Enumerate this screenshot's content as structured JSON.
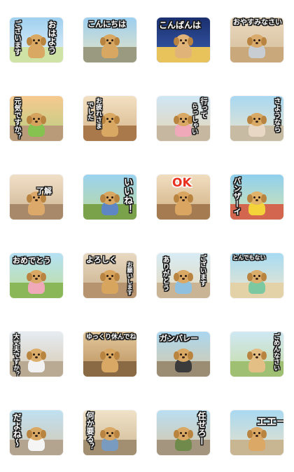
{
  "stickers": [
    {
      "lines": [
        "おはよう",
        "ございます"
      ],
      "bg": [
        "#9fd0ef",
        "#e9f3fa"
      ],
      "ground": "#cfe3a6",
      "fur": "#d9a964",
      "outfit": ""
    },
    {
      "lines": [
        "こんにちは"
      ],
      "bg": [
        "#9ccff0",
        "#e8e4c4"
      ],
      "ground": "#9a9a80",
      "fur": "#d8a862",
      "outfit": ""
    },
    {
      "lines": [
        "こんばんは"
      ],
      "bg": [
        "#1a2f6e",
        "#3a5fb0"
      ],
      "ground": "#e8c25a",
      "fur": "#e0b478",
      "outfit": ""
    },
    {
      "lines": [
        "おやすみなさい"
      ],
      "bg": [
        "#ead9bf",
        "#d3bc98"
      ],
      "ground": "#c9a87b",
      "fur": "#d9ab6c",
      "outfit": "#c8cdd4"
    },
    {
      "lines": [
        "元気ですか？"
      ],
      "bg": [
        "#f7c98f",
        "#b7cf83"
      ],
      "ground": "#b99b7a",
      "fur": "#d6a35e",
      "outfit": "#86c24f"
    },
    {
      "lines": [
        "お疲れさま",
        "でした"
      ],
      "bg": [
        "#f3e0c2",
        "#d4b58a"
      ],
      "ground": "#a9794c",
      "fur": "#d9a862",
      "outfit": ""
    },
    {
      "lines": [
        "行って",
        "らっしゃい"
      ],
      "bg": [
        "#cfe6f5",
        "#e6d5b4"
      ],
      "ground": "#c6b7a0",
      "fur": "#d9a864",
      "outfit": "#f0a9b8"
    },
    {
      "lines": [
        "さようなら"
      ],
      "bg": [
        "#a8d8f2",
        "#ece4cc"
      ],
      "ground": "#c7bba4",
      "fur": "#d9aa66",
      "outfit": "#e9d7c6"
    },
    {
      "lines": [
        "了解"
      ],
      "bg": [
        "#f0dfc7",
        "#cdb391"
      ],
      "ground": "#a88a6a",
      "fur": "#dca96a",
      "outfit": ""
    },
    {
      "lines": [
        "いいね！"
      ],
      "bg": [
        "#9bd3f0",
        "#bcd99b"
      ],
      "ground": "#7aa24a",
      "fur": "#d8a862",
      "outfit": "#5f86c4"
    },
    {
      "lines": [
        "OK"
      ],
      "bg": [
        "#f0ddc0",
        "#cfae80"
      ],
      "ground": "#a57c52",
      "fur": "#d9a560",
      "outfit": ""
    },
    {
      "lines": [
        "バンザーイ"
      ],
      "bg": [
        "#8fd0ee",
        "#d6e4b0"
      ],
      "ground": "#d3664f",
      "fur": "#e0b26a",
      "outfit": "#f3d23a"
    },
    {
      "lines": [
        "おめでとう"
      ],
      "bg": [
        "#b4e0f4",
        "#c2df9a"
      ],
      "ground": "#8ab858",
      "fur": "#d9a864",
      "outfit": "#f0a9b8"
    },
    {
      "lines": [
        "よろしく",
        "お願いします"
      ],
      "bg": [
        "#e8d9c2",
        "#c7ae88"
      ],
      "ground": "#b69470",
      "fur": "#d8a55e",
      "outfit": ""
    },
    {
      "lines": [
        "ありがとう",
        "ございます"
      ],
      "bg": [
        "#d7ecf5",
        "#e8d8b8"
      ],
      "ground": "#c9b596",
      "fur": "#d9a864",
      "outfit": "#8fc0e0"
    },
    {
      "lines": [
        "とんでもない"
      ],
      "bg": [
        "#a6dbf3",
        "#f0e6cc"
      ],
      "ground": "#e3d2a8",
      "fur": "#dcae6e",
      "outfit": "#7cc8a0"
    },
    {
      "lines": [
        "大丈夫ですか？"
      ],
      "bg": [
        "#e5ecf2",
        "#d8c8b0"
      ],
      "ground": "#b9aa94",
      "fur": "#dcae6c",
      "outfit": "#f2f2f2"
    },
    {
      "lines": [
        "ゆっくり休んでね"
      ],
      "bg": [
        "#e2c89c",
        "#b98e5c"
      ],
      "ground": "#8a6a44",
      "fur": "#d9a864",
      "outfit": ""
    },
    {
      "lines": [
        "ガンバレー"
      ],
      "bg": [
        "#aad7f0",
        "#d9c9a6"
      ],
      "ground": "#9b8c74",
      "fur": "#d9a864",
      "outfit": "#3b3b3b"
    },
    {
      "lines": [
        "ごめんなさい"
      ],
      "bg": [
        "#cfe8f3",
        "#c8dca2"
      ],
      "ground": "#9fbf72",
      "fur": "#e3bf86",
      "outfit": ""
    },
    {
      "lines": [
        "だよね〜"
      ],
      "bg": [
        "#bfe0f2",
        "#d6c8b0"
      ],
      "ground": "#b2a48e",
      "fur": "#d9a864",
      "outfit": "#f5f5f5"
    },
    {
      "lines": [
        "何か要る？"
      ],
      "bg": [
        "#f0e2c8",
        "#cdb894"
      ],
      "ground": "#a28f72",
      "fur": "#d9a864",
      "outfit": "#7a9bc0"
    },
    {
      "lines": [
        "任せろー"
      ],
      "bg": [
        "#b9dff2",
        "#d8c4a4"
      ],
      "ground": "#a4957e",
      "fur": "#d9a864",
      "outfit": "#6f8a4a"
    },
    {
      "lines": [
        "エエー"
      ],
      "bg": [
        "#a9d9f1",
        "#e9e1c9"
      ],
      "ground": "#c8b693",
      "fur": "#dba866",
      "outfit": ""
    }
  ]
}
